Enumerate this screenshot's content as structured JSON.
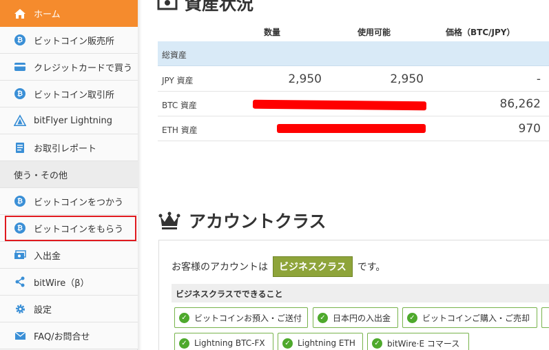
{
  "sidebar": {
    "items": [
      {
        "label": "ホーム",
        "icon": "home-icon"
      },
      {
        "label": "ビットコイン販売所",
        "icon": "bitcoin-icon"
      },
      {
        "label": "クレジットカードで買う",
        "icon": "credit-card-icon"
      },
      {
        "label": "ビットコイン取引所",
        "icon": "bitcoin-icon"
      },
      {
        "label": "bitFlyer Lightning",
        "icon": "lightning-icon"
      },
      {
        "label": "お取引レポート",
        "icon": "report-icon"
      },
      {
        "label": "ビットコインをつかう",
        "icon": "bitcoin-icon"
      },
      {
        "label": "ビットコインをもらう",
        "icon": "bitcoin-icon"
      },
      {
        "label": "入出金",
        "icon": "money-icon"
      },
      {
        "label": "bitWire（β）",
        "icon": "share-icon"
      },
      {
        "label": "設定",
        "icon": "gear-icon"
      },
      {
        "label": "FAQ/お問合せ",
        "icon": "mail-icon"
      }
    ],
    "section_label": "使う・その他"
  },
  "assets": {
    "title": "資産状況",
    "columns": [
      "数量",
      "使用可能",
      "価格（BTC/JPY）"
    ],
    "total_label": "総資産",
    "rows": [
      {
        "label": "JPY 資産",
        "qty": "2,950",
        "avail": "2,950",
        "price": "-"
      },
      {
        "label": "BTC 資産",
        "qty": "",
        "avail": "",
        "price": "86,262"
      },
      {
        "label": "ETH 資産",
        "qty": "",
        "avail": "",
        "price": "970"
      }
    ]
  },
  "account": {
    "title": "アカウントクラス",
    "text_before": "お客様のアカウントは",
    "class_name": "ビジネスクラス",
    "text_after": "です。",
    "can_do_heading": "ビジネスクラスでできること",
    "features": [
      "ビットコインお預入・ご送付",
      "日本円の入出金",
      "ビットコインご購入・ご売却",
      "Lightning BTC-FX",
      "Lightning ETH",
      "bitWire·E コマース"
    ]
  },
  "colors": {
    "home_active": "#f58b2d",
    "bitcoin_blue": "#3a8fd6",
    "highlight_red": "#e0191e",
    "badge_green": "#8ea43a",
    "check_green": "#4ea92c",
    "total_row": "#d9eaf7"
  }
}
